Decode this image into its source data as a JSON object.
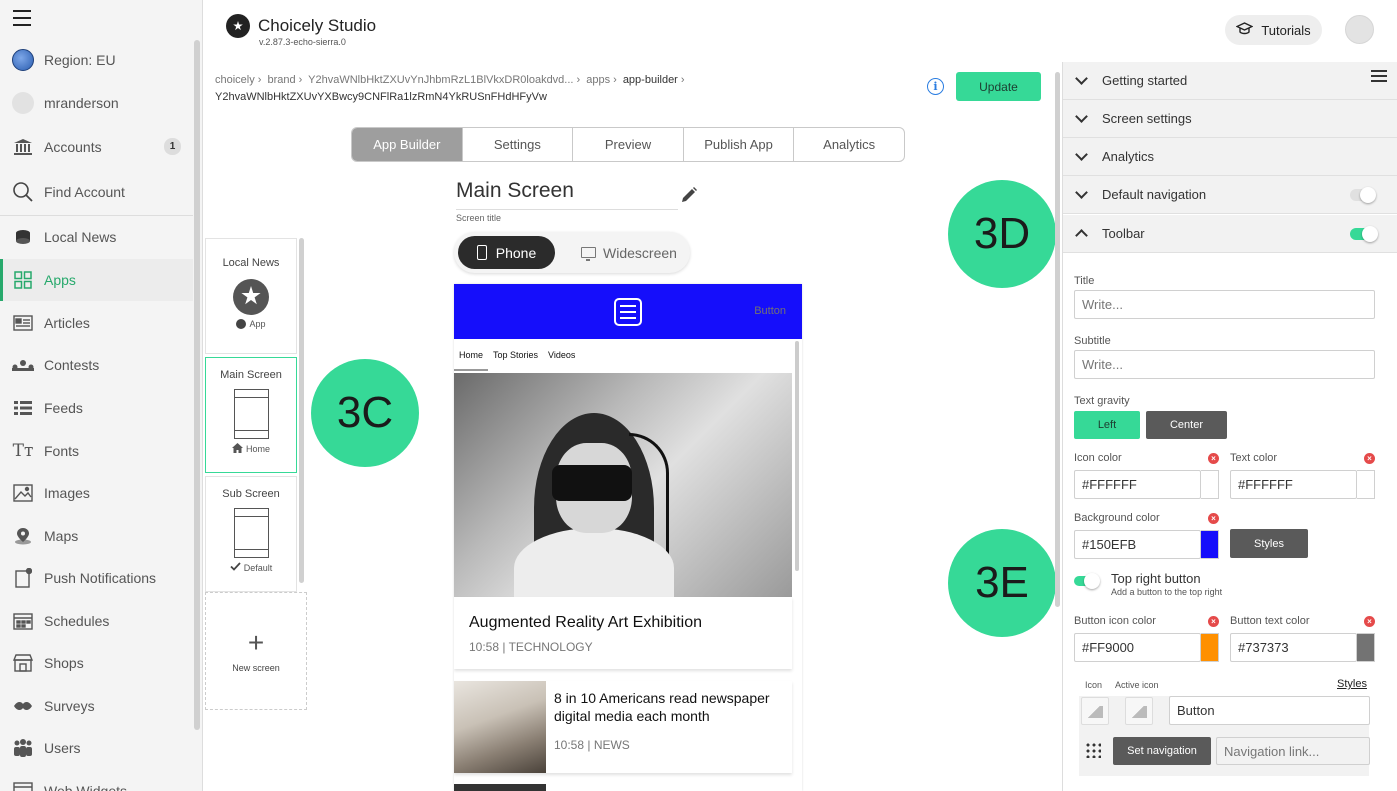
{
  "sidebar": {
    "region": "Region: EU",
    "user": "mranderson",
    "items": [
      {
        "label": "Accounts",
        "badge": "1",
        "icon": "bank-icon"
      },
      {
        "label": "Find Account",
        "icon": "search-icon"
      },
      {
        "label": "Local News",
        "icon": "hat-icon"
      },
      {
        "label": "Apps",
        "icon": "grid-icon",
        "active": true
      },
      {
        "label": "Articles",
        "icon": "article-icon"
      },
      {
        "label": "Contests",
        "icon": "contest-icon"
      },
      {
        "label": "Feeds",
        "icon": "feed-icon"
      },
      {
        "label": "Fonts",
        "icon": "font-icon"
      },
      {
        "label": "Images",
        "icon": "image-icon"
      },
      {
        "label": "Maps",
        "icon": "map-pin-icon"
      },
      {
        "label": "Push Notifications",
        "icon": "push-icon"
      },
      {
        "label": "Schedules",
        "icon": "calendar-icon"
      },
      {
        "label": "Shops",
        "icon": "shop-icon"
      },
      {
        "label": "Surveys",
        "icon": "survey-icon"
      },
      {
        "label": "Users",
        "icon": "users-icon"
      },
      {
        "label": "Web Widgets",
        "icon": "widget-icon"
      }
    ]
  },
  "header": {
    "title": "Choicely Studio",
    "version": "v.2.87.3-echo-sierra.0",
    "tutorials": "Tutorials"
  },
  "breadcrumb": {
    "items": [
      "choicely",
      "brand",
      "Y2hvaWNlbHktZXUvYnJhbmRzL1BlVkxDR0loakdvd...",
      "apps",
      "app-builder"
    ],
    "id": "Y2hvaWNlbHktZXUvYXBwcy9CNFlRa1lzRmN4YkRUSnFHdHFyVw"
  },
  "update_label": "Update",
  "tabs": [
    "App Builder",
    "Settings",
    "Preview",
    "Publish App",
    "Analytics"
  ],
  "screen": {
    "title": "Main Screen",
    "title_label": "Screen title",
    "device_phone": "Phone",
    "device_wide": "Widescreen"
  },
  "screens": [
    {
      "name": "Local News",
      "sub": "App"
    },
    {
      "name": "Main Screen",
      "sub": "Home"
    },
    {
      "name": "Sub Screen",
      "sub": "Default"
    }
  ],
  "new_screen": "New screen",
  "markers": {
    "c": "3C",
    "d": "3D",
    "e": "3E"
  },
  "preview": {
    "toolbar_color": "#150EFB",
    "button_label": "Button",
    "nav": [
      "Home",
      "Top Stories",
      "Videos"
    ],
    "article1": {
      "title": "Augmented Reality Art Exhibition",
      "meta": "10:58 | TECHNOLOGY"
    },
    "article2": {
      "title": "8 in 10 Americans read newspaper digital media each month",
      "meta": "10:58 | NEWS"
    }
  },
  "panel": {
    "sections": [
      "Getting started",
      "Screen settings",
      "Analytics",
      "Default navigation",
      "Toolbar"
    ],
    "title_label": "Title",
    "title_placeholder": "Write...",
    "subtitle_label": "Subtitle",
    "subtitle_placeholder": "Write...",
    "gravity_label": "Text gravity",
    "gravity_left": "Left",
    "gravity_center": "Center",
    "icon_color_label": "Icon color",
    "icon_color": "#FFFFFF",
    "text_color_label": "Text color",
    "text_color": "#FFFFFF",
    "bg_color_label": "Background color",
    "bg_color": "#150EFB",
    "styles": "Styles",
    "top_right_label": "Top right button",
    "top_right_desc": "Add a button to the top right",
    "btn_icon_color_label": "Button icon color",
    "btn_icon_color": "#FF9000",
    "btn_text_color_label": "Button text color",
    "btn_text_color": "#737373",
    "icon_label": "Icon",
    "active_icon_label": "Active icon",
    "styles_link": "Styles",
    "button_value": "Button",
    "set_navigation": "Set navigation",
    "nav_link_placeholder": "Navigation link..."
  }
}
